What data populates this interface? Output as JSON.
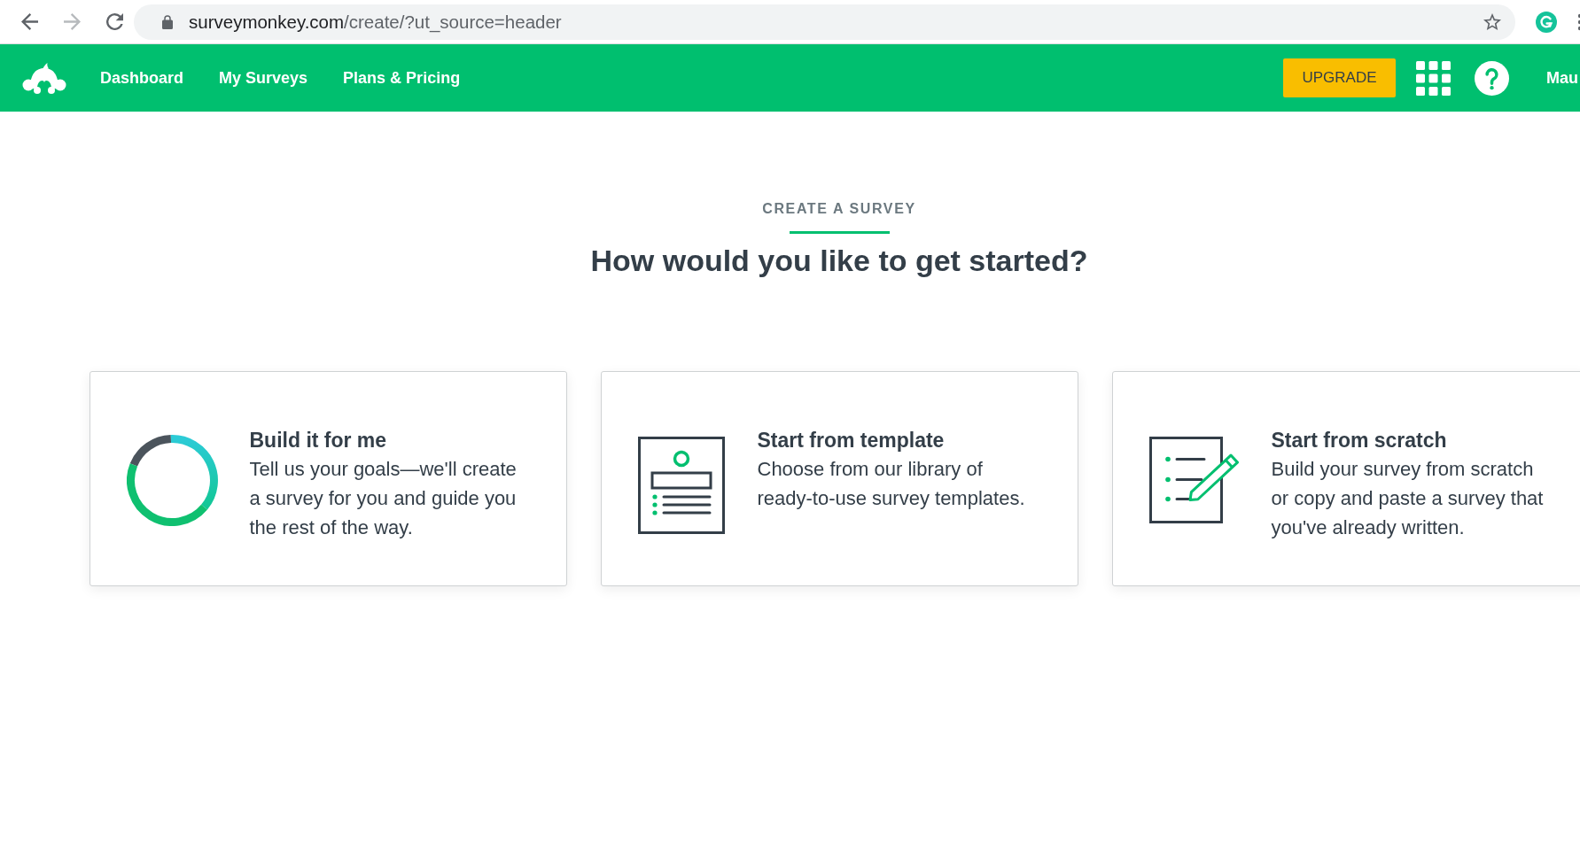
{
  "browser": {
    "nav_buttons": [
      {
        "kind": "back",
        "disabled": false
      },
      {
        "kind": "forward",
        "disabled": true
      },
      {
        "kind": "reload",
        "disabled": false
      }
    ],
    "url": {
      "host": "surveymonkey.com",
      "path": "/create/?ut_source=header"
    }
  },
  "header": {
    "nav": [
      {
        "label": "Dashboard"
      },
      {
        "label": "My Surveys"
      },
      {
        "label": "Plans & Pricing"
      }
    ],
    "upgrade": "UPGRADE",
    "user_name": "Mau"
  },
  "intro": {
    "eyebrow": "CREATE A SURVEY",
    "heading": "How would you like to get started?"
  },
  "options": [
    {
      "kind": "build",
      "title": "Build it for me",
      "description": "Tell us your goals—we'll create a survey for you and guide you the rest of the way."
    },
    {
      "kind": "template",
      "title": "Start from template",
      "description": "Choose from our library of ready-to-use survey templates."
    },
    {
      "kind": "scratch",
      "title": "Start from scratch",
      "description": "Build your survey from scratch or copy and paste a survey that you've already written."
    }
  ]
}
